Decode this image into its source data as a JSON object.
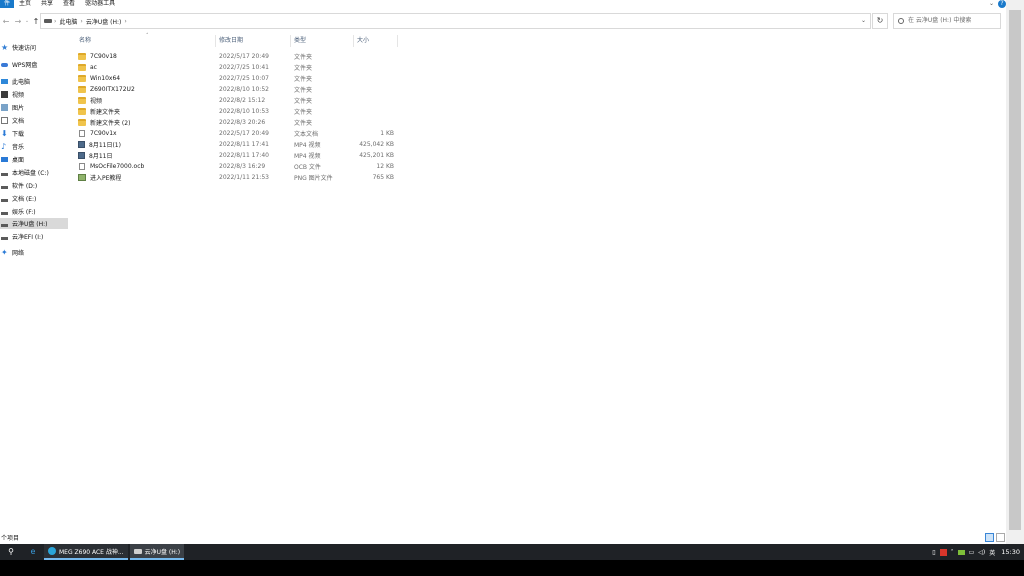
{
  "ribbon": {
    "tabs": [
      "件",
      "主页",
      "共享",
      "查看",
      "驱动器工具"
    ]
  },
  "address": {
    "crumbs": [
      "此电脑",
      "云净U盘 (H:)"
    ],
    "search_placeholder": "在 云净U盘 (H:) 中搜索"
  },
  "nav": {
    "items": [
      {
        "label": "快速访问",
        "icon": "star-icon"
      },
      {
        "label": "WPS网盘",
        "icon": "cloud-icon"
      },
      {
        "label": "此电脑",
        "icon": "computer-icon"
      },
      {
        "label": "视频",
        "icon": "video-folder-icon"
      },
      {
        "label": "图片",
        "icon": "pictures-folder-icon"
      },
      {
        "label": "文档",
        "icon": "documents-folder-icon"
      },
      {
        "label": "下载",
        "icon": "download-icon"
      },
      {
        "label": "音乐",
        "icon": "music-icon"
      },
      {
        "label": "桌面",
        "icon": "desktop-icon"
      },
      {
        "label": "本地磁盘 (C:)",
        "icon": "drive-icon"
      },
      {
        "label": "软件 (D:)",
        "icon": "drive-icon"
      },
      {
        "label": "文档 (E:)",
        "icon": "drive-icon"
      },
      {
        "label": "娱乐 (F:)",
        "icon": "drive-icon"
      },
      {
        "label": "云净U盘 (H:)",
        "icon": "drive-icon",
        "selected": true
      },
      {
        "label": "云净EFI (I:)",
        "icon": "drive-icon"
      },
      {
        "label": "网络",
        "icon": "network-icon"
      }
    ]
  },
  "columns": {
    "name": "名称",
    "date": "修改日期",
    "type": "类型",
    "size": "大小"
  },
  "files": [
    {
      "name": "7C90v18",
      "date": "2022/5/17 20:49",
      "type": "文件夹",
      "size": "",
      "icon": "folder-icon"
    },
    {
      "name": "ac",
      "date": "2022/7/25 10:41",
      "type": "文件夹",
      "size": "",
      "icon": "folder-icon"
    },
    {
      "name": "Win10x64",
      "date": "2022/7/25 10:07",
      "type": "文件夹",
      "size": "",
      "icon": "folder-icon"
    },
    {
      "name": "Z690ITX172U2",
      "date": "2022/8/10 10:52",
      "type": "文件夹",
      "size": "",
      "icon": "folder-icon"
    },
    {
      "name": "视频",
      "date": "2022/8/2 15:12",
      "type": "文件夹",
      "size": "",
      "icon": "folder-icon"
    },
    {
      "name": "新建文件夹",
      "date": "2022/8/10 10:53",
      "type": "文件夹",
      "size": "",
      "icon": "folder-icon"
    },
    {
      "name": "新建文件夹 (2)",
      "date": "2022/8/3 20:26",
      "type": "文件夹",
      "size": "",
      "icon": "folder-icon"
    },
    {
      "name": "7C90v1x",
      "date": "2022/5/17 20:49",
      "type": "文本文档",
      "size": "1 KB",
      "icon": "text-file-icon"
    },
    {
      "name": "8月11日(1)",
      "date": "2022/8/11 17:41",
      "type": "MP4 视频",
      "size": "425,042 KB",
      "icon": "video-file-icon"
    },
    {
      "name": "8月11日",
      "date": "2022/8/11 17:40",
      "type": "MP4 视频",
      "size": "425,201 KB",
      "icon": "video-file-icon"
    },
    {
      "name": "MsOcFile7000.ocb",
      "date": "2022/8/3 16:29",
      "type": "OCB 文件",
      "size": "12 KB",
      "icon": "ocb-file-icon"
    },
    {
      "name": "进入PE教程",
      "date": "2022/1/11 21:53",
      "type": "PNG 图片文件",
      "size": "765 KB",
      "icon": "image-file-icon"
    }
  ],
  "status": {
    "count": "个项目"
  },
  "taskbar": {
    "apps": [
      {
        "label": "MEG Z690 ACE 战神...",
        "icon": "edge-browser-icon"
      },
      {
        "label": "云净U盘 (H:)",
        "icon": "drive-icon"
      }
    ],
    "tray": {
      "ime": "英",
      "volume": "ↈ",
      "time": "15:30"
    }
  }
}
